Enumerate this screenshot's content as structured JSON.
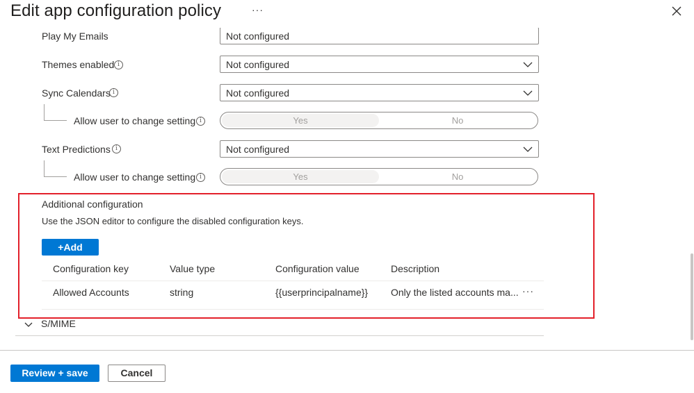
{
  "header": {
    "title": "Edit app configuration policy",
    "more_label": "···"
  },
  "settings": {
    "partial_row": {
      "label": "Play My Emails",
      "value": "Not configured"
    },
    "themes": {
      "label": "Themes enabled",
      "value": "Not configured"
    },
    "sync_calendars": {
      "label": "Sync Calendars",
      "value": "Not configured",
      "child": {
        "label": "Allow user to change setting",
        "yes": "Yes",
        "no": "No",
        "selected": "Yes"
      }
    },
    "text_predictions": {
      "label": "Text Predictions",
      "value": "Not configured",
      "child": {
        "label": "Allow user to change setting",
        "yes": "Yes",
        "no": "No",
        "selected": "Yes"
      }
    }
  },
  "additional": {
    "title": "Additional configuration",
    "description": "Use the JSON editor to configure the disabled configuration keys.",
    "add_label": "+Add",
    "columns": [
      "Configuration key",
      "Value type",
      "Configuration value",
      "Description"
    ],
    "rows": [
      {
        "key": "Allowed Accounts",
        "type": "string",
        "value": "{{userprincipalname}}",
        "description": "Only the listed accounts ma...",
        "more": "···"
      }
    ]
  },
  "smime": {
    "label": "S/MIME"
  },
  "footer": {
    "primary_label": "Review + save",
    "secondary_label": "Cancel"
  },
  "colors": {
    "accent": "#0078d4",
    "highlight_border": "#e3202a"
  },
  "icons": {
    "close": "close-icon",
    "info": "info-icon",
    "chevron": "chevron-down-icon",
    "collapse": "chevron-down-icon"
  }
}
